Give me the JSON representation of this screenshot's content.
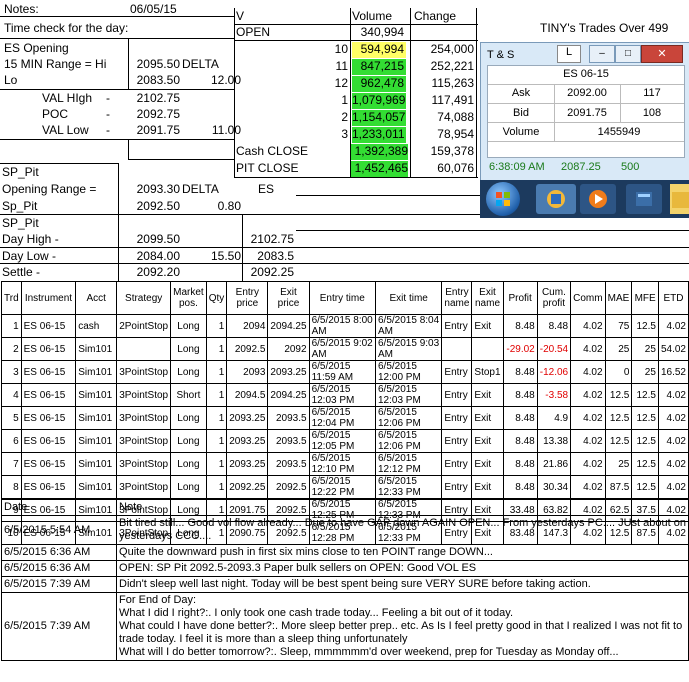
{
  "header": {
    "notes_label": "Notes:",
    "notes_date": "06/05/15",
    "time_check": "Time check for the day:",
    "title": "TINY's Trades Over 499"
  },
  "es_block": {
    "opening": "ES Opening",
    "range_label": "15 MIN Range = Hi",
    "range_hi": "2095.50",
    "delta_label": "DELTA",
    "lo_label": "Lo",
    "lo_value": "2083.50",
    "delta_value": "12.00",
    "vah_label": "VAL HIgh",
    "vah_dash": "-",
    "vah_value": "2102.75",
    "poc_label": "POC",
    "poc_dash": "-",
    "poc_value": "2092.75",
    "val_label": "VAL Low",
    "val_dash": "-",
    "val_value": "2091.75",
    "val_extra": "11.00"
  },
  "volume_block": {
    "col_v": "V",
    "col_volume": "Volume",
    "col_change": "Change",
    "open_label": "OPEN",
    "open_volume": "340,994",
    "rows": [
      {
        "label": "10",
        "volume": "594,994",
        "change": "254,000",
        "color": "#ffff66"
      },
      {
        "label": "11",
        "volume": "847,215",
        "change": "252,221",
        "color": "#33dd33"
      },
      {
        "label": "12",
        "volume": "962,478",
        "change": "115,263",
        "color": "#33dd33"
      },
      {
        "label": "1",
        "volume": "1,079,969",
        "change": "117,491",
        "color": "#33dd33"
      },
      {
        "label": "2",
        "volume": "1,154,057",
        "change": "74,088",
        "color": "#33dd33"
      },
      {
        "label": "3",
        "volume": "1,233,011",
        "change": "78,954",
        "color": "#33dd33"
      }
    ],
    "cash_close_label": "Cash CLOSE",
    "cash_close_volume": "1,392,389",
    "cash_close_change": "159,378",
    "pit_close_label": "PIT CLOSE",
    "pit_close_volume": "1,452,465",
    "pit_close_change": "60,076"
  },
  "pit_block": {
    "sp_pit": "SP_Pit",
    "opening_range_label": "Opening Range =",
    "opening_range_value": "2093.30",
    "delta_label": "DELTA",
    "es_label": "ES",
    "sp_pit2": "Sp_Pit",
    "sp_pit2_value": "2092.50",
    "sp_pit2_delta": "0.80",
    "sp_pit3": "SP_Pit",
    "day_high_label": "Day High -",
    "day_high_value": "2099.50",
    "day_high_es": "2102.75",
    "day_low_label": "Day Low -",
    "day_low_value": "2084.00",
    "day_low_delta": "15.50",
    "day_low_es": "2083.5",
    "settle_label": "Settle -",
    "settle_value": "2092.20",
    "settle_es": "2092.25"
  },
  "ts_window": {
    "title": "T & S",
    "l_label": "L",
    "symbol": "ES 06-15",
    "ask_label": "Ask",
    "ask_price": "2092.00",
    "ask_size": "117",
    "bid_label": "Bid",
    "bid_price": "2091.75",
    "bid_size": "108",
    "volume_label": "Volume",
    "volume_value": "1455949",
    "last_time": "6:38:09 AM",
    "last_price": "2087.25",
    "last_size": "500"
  },
  "trades": {
    "headers": [
      "Trd",
      "Instrument",
      "Acct",
      "Strategy",
      "Market pos.",
      "Qty",
      "Entry price",
      "Exit price",
      "Entry time",
      "Exit time",
      "Entry name",
      "Exit name",
      "Profit",
      "Cum. profit",
      "Comm",
      "MAE",
      "MFE",
      "ETD"
    ],
    "rows": [
      [
        "1",
        "ES 06-15",
        "cash",
        "2PointStop",
        "Long",
        "1",
        "2094",
        "2094.25",
        "6/5/2015 8:00 AM",
        "6/5/2015 8:04 AM",
        "Entry",
        "Exit",
        "8.48",
        "8.48",
        "4.02",
        "75",
        "12.5",
        "4.02"
      ],
      [
        "2",
        "ES 06-15",
        "Sim101",
        "",
        "Long",
        "1",
        "2092.5",
        "2092",
        "6/5/2015 9:02 AM",
        "6/5/2015 9:03 AM",
        "",
        "",
        "-29.02",
        "-20.54",
        "4.02",
        "25",
        "25",
        "54.02"
      ],
      [
        "3",
        "ES 06-15",
        "Sim101",
        "3PointStop",
        "Long",
        "1",
        "2093",
        "2093.25",
        "6/5/2015 11:59 AM",
        "6/5/2015 12:00 PM",
        "Entry",
        "Stop1",
        "8.48",
        "-12.06",
        "4.02",
        "0",
        "25",
        "16.52"
      ],
      [
        "4",
        "ES 06-15",
        "Sim101",
        "3PointStop",
        "Short",
        "1",
        "2094.5",
        "2094.25",
        "6/5/2015 12:03 PM",
        "6/5/2015 12:03 PM",
        "Entry",
        "Exit",
        "8.48",
        "-3.58",
        "4.02",
        "12.5",
        "12.5",
        "4.02"
      ],
      [
        "5",
        "ES 06-15",
        "Sim101",
        "3PointStop",
        "Long",
        "1",
        "2093.25",
        "2093.5",
        "6/5/2015 12:04 PM",
        "6/5/2015 12:06 PM",
        "Entry",
        "Exit",
        "8.48",
        "4.9",
        "4.02",
        "12.5",
        "12.5",
        "4.02"
      ],
      [
        "6",
        "ES 06-15",
        "Sim101",
        "3PointStop",
        "Long",
        "1",
        "2093.25",
        "2093.5",
        "6/5/2015 12:05 PM",
        "6/5/2015 12:06 PM",
        "Entry",
        "Exit",
        "8.48",
        "13.38",
        "4.02",
        "12.5",
        "12.5",
        "4.02"
      ],
      [
        "7",
        "ES 06-15",
        "Sim101",
        "3PointStop",
        "Long",
        "1",
        "2093.25",
        "2093.5",
        "6/5/2015 12:10 PM",
        "6/5/2015 12:12 PM",
        "Entry",
        "Exit",
        "8.48",
        "21.86",
        "4.02",
        "25",
        "12.5",
        "4.02"
      ],
      [
        "8",
        "ES 06-15",
        "Sim101",
        "3PointStop",
        "Long",
        "1",
        "2092.25",
        "2092.5",
        "6/5/2015 12:22 PM",
        "6/5/2015 12:33 PM",
        "Entry",
        "Exit",
        "8.48",
        "30.34",
        "4.02",
        "87.5",
        "12.5",
        "4.02"
      ],
      [
        "9",
        "ES 06-15",
        "Sim101",
        "3PointStop",
        "Long",
        "1",
        "2091.75",
        "2092.5",
        "6/5/2015 12:25 PM",
        "6/5/2015 12:33 PM",
        "Entry",
        "Exit",
        "33.48",
        "63.82",
        "4.02",
        "62.5",
        "37.5",
        "4.02"
      ],
      [
        "10",
        "ES 06-15",
        "Sim101",
        "3PointStop",
        "Long",
        "1",
        "2090.75",
        "2092.5",
        "6/5/2015 12:28 PM",
        "6/5/2015 12:33 PM",
        "Entry",
        "Exit",
        "83.48",
        "147.3",
        "4.02",
        "12.5",
        "87.5",
        "4.02"
      ]
    ]
  },
  "notes": {
    "col_date": "Date",
    "col_note": "Note",
    "rows": [
      {
        "date": "6/5/2015 5:54 AM",
        "lines": [
          "Bit tired still... Good vol flow already... Due to have GAP down AGAIN OPEN... From yesterdays PC.... JUst about on",
          "yesterdays CCC...."
        ]
      },
      {
        "date": "6/5/2015 6:36 AM",
        "lines": [
          "Quite the downward push in first six mins close to ten POINT range DOWN..."
        ]
      },
      {
        "date": "6/5/2015 6:36 AM",
        "lines": [
          "OPEN:  SP Pit 2092.5-2093.3 Paper bulk sellers on OPEN: Good VOL ES"
        ]
      },
      {
        "date": "6/5/2015 7:39 AM",
        "lines": [
          "Didn't sleep well last night.  Today will be best spent being sure VERY SURE before taking action."
        ]
      },
      {
        "date": "6/5/2015 7:39 AM",
        "lines": [
          "For End of Day:",
          "What I did I right?:.  I only took one cash trade today... Feeling a bit out of it today.",
          "What could I have done better?:.  More sleep better prep.. etc.  As Is I feel pretty good in that I realized I was not fit to",
          "trade today.  I feel it is more than a sleep thing unfortunately",
          "What will I do better tomorrow?:.  Sleep, mmmmmm'd over weekend, prep for Tuesday as Monday off..."
        ]
      }
    ]
  }
}
